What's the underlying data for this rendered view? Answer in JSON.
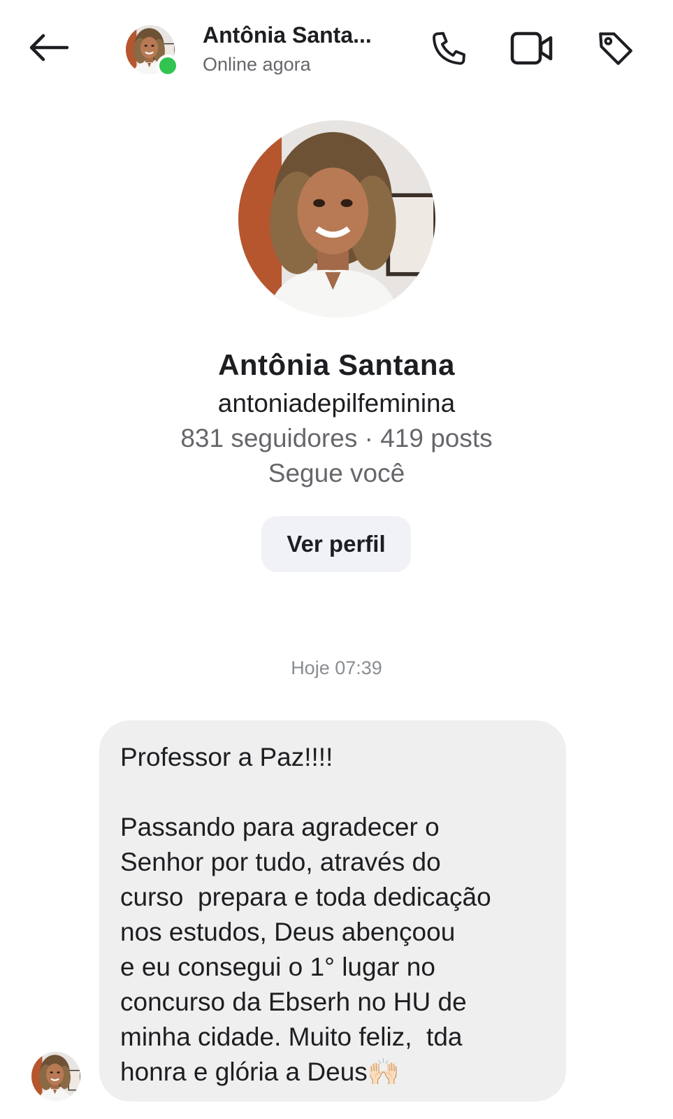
{
  "header": {
    "name": "Antônia Santa...",
    "status": "Online agora",
    "icons": {
      "back": "arrow-left-icon",
      "call": "phone-icon",
      "video": "video-camera-icon",
      "label": "tag-icon"
    },
    "online_color": "#31c450"
  },
  "profile": {
    "name": "Antônia Santana",
    "username": "antoniadepilfeminina",
    "stats": "831 seguidores · 419 posts",
    "follows_you": "Segue você",
    "view_profile_label": "Ver perfil"
  },
  "conversation": {
    "timestamp": "Hoje 07:39",
    "messages": [
      {
        "sender": "Antônia Santana",
        "text": "Professor a Paz!!!!\n\nPassando para agradecer o\nSenhor por tudo, através do\ncurso  prepara e toda dedicação\nnos estudos, Deus abençoou\ne eu consegui o 1° lugar no\nconcurso da Ebserh no HU de\nminha cidade. Muito feliz,  tda\nhonra e glória a Deus🙌🏻"
      }
    ]
  }
}
